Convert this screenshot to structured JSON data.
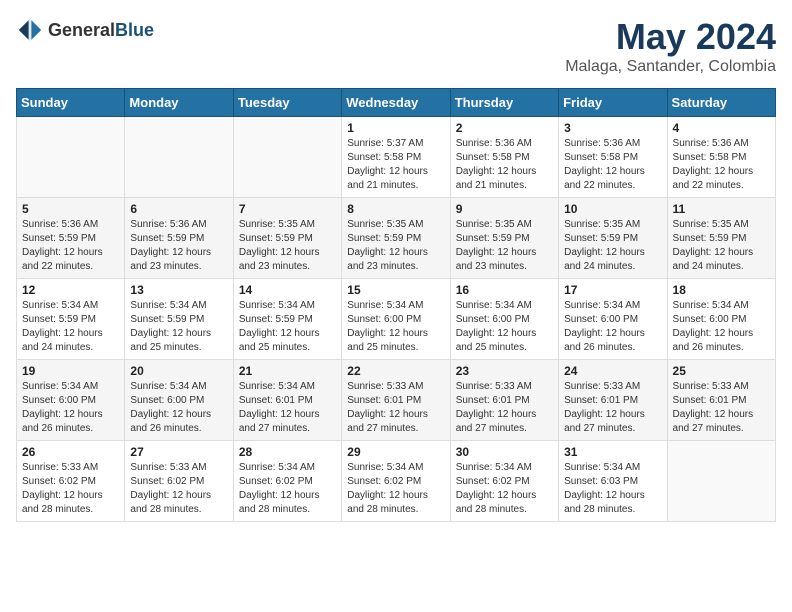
{
  "header": {
    "logo_general": "General",
    "logo_blue": "Blue",
    "title": "May 2024",
    "subtitle": "Malaga, Santander, Colombia"
  },
  "weekdays": [
    "Sunday",
    "Monday",
    "Tuesday",
    "Wednesday",
    "Thursday",
    "Friday",
    "Saturday"
  ],
  "weeks": [
    {
      "days": [
        {
          "num": "",
          "info": ""
        },
        {
          "num": "",
          "info": ""
        },
        {
          "num": "",
          "info": ""
        },
        {
          "num": "1",
          "info": "Sunrise: 5:37 AM\nSunset: 5:58 PM\nDaylight: 12 hours\nand 21 minutes."
        },
        {
          "num": "2",
          "info": "Sunrise: 5:36 AM\nSunset: 5:58 PM\nDaylight: 12 hours\nand 21 minutes."
        },
        {
          "num": "3",
          "info": "Sunrise: 5:36 AM\nSunset: 5:58 PM\nDaylight: 12 hours\nand 22 minutes."
        },
        {
          "num": "4",
          "info": "Sunrise: 5:36 AM\nSunset: 5:58 PM\nDaylight: 12 hours\nand 22 minutes."
        }
      ]
    },
    {
      "days": [
        {
          "num": "5",
          "info": "Sunrise: 5:36 AM\nSunset: 5:59 PM\nDaylight: 12 hours\nand 22 minutes."
        },
        {
          "num": "6",
          "info": "Sunrise: 5:36 AM\nSunset: 5:59 PM\nDaylight: 12 hours\nand 23 minutes."
        },
        {
          "num": "7",
          "info": "Sunrise: 5:35 AM\nSunset: 5:59 PM\nDaylight: 12 hours\nand 23 minutes."
        },
        {
          "num": "8",
          "info": "Sunrise: 5:35 AM\nSunset: 5:59 PM\nDaylight: 12 hours\nand 23 minutes."
        },
        {
          "num": "9",
          "info": "Sunrise: 5:35 AM\nSunset: 5:59 PM\nDaylight: 12 hours\nand 23 minutes."
        },
        {
          "num": "10",
          "info": "Sunrise: 5:35 AM\nSunset: 5:59 PM\nDaylight: 12 hours\nand 24 minutes."
        },
        {
          "num": "11",
          "info": "Sunrise: 5:35 AM\nSunset: 5:59 PM\nDaylight: 12 hours\nand 24 minutes."
        }
      ]
    },
    {
      "days": [
        {
          "num": "12",
          "info": "Sunrise: 5:34 AM\nSunset: 5:59 PM\nDaylight: 12 hours\nand 24 minutes."
        },
        {
          "num": "13",
          "info": "Sunrise: 5:34 AM\nSunset: 5:59 PM\nDaylight: 12 hours\nand 25 minutes."
        },
        {
          "num": "14",
          "info": "Sunrise: 5:34 AM\nSunset: 5:59 PM\nDaylight: 12 hours\nand 25 minutes."
        },
        {
          "num": "15",
          "info": "Sunrise: 5:34 AM\nSunset: 6:00 PM\nDaylight: 12 hours\nand 25 minutes."
        },
        {
          "num": "16",
          "info": "Sunrise: 5:34 AM\nSunset: 6:00 PM\nDaylight: 12 hours\nand 25 minutes."
        },
        {
          "num": "17",
          "info": "Sunrise: 5:34 AM\nSunset: 6:00 PM\nDaylight: 12 hours\nand 26 minutes."
        },
        {
          "num": "18",
          "info": "Sunrise: 5:34 AM\nSunset: 6:00 PM\nDaylight: 12 hours\nand 26 minutes."
        }
      ]
    },
    {
      "days": [
        {
          "num": "19",
          "info": "Sunrise: 5:34 AM\nSunset: 6:00 PM\nDaylight: 12 hours\nand 26 minutes."
        },
        {
          "num": "20",
          "info": "Sunrise: 5:34 AM\nSunset: 6:00 PM\nDaylight: 12 hours\nand 26 minutes."
        },
        {
          "num": "21",
          "info": "Sunrise: 5:34 AM\nSunset: 6:01 PM\nDaylight: 12 hours\nand 27 minutes."
        },
        {
          "num": "22",
          "info": "Sunrise: 5:33 AM\nSunset: 6:01 PM\nDaylight: 12 hours\nand 27 minutes."
        },
        {
          "num": "23",
          "info": "Sunrise: 5:33 AM\nSunset: 6:01 PM\nDaylight: 12 hours\nand 27 minutes."
        },
        {
          "num": "24",
          "info": "Sunrise: 5:33 AM\nSunset: 6:01 PM\nDaylight: 12 hours\nand 27 minutes."
        },
        {
          "num": "25",
          "info": "Sunrise: 5:33 AM\nSunset: 6:01 PM\nDaylight: 12 hours\nand 27 minutes."
        }
      ]
    },
    {
      "days": [
        {
          "num": "26",
          "info": "Sunrise: 5:33 AM\nSunset: 6:02 PM\nDaylight: 12 hours\nand 28 minutes."
        },
        {
          "num": "27",
          "info": "Sunrise: 5:33 AM\nSunset: 6:02 PM\nDaylight: 12 hours\nand 28 minutes."
        },
        {
          "num": "28",
          "info": "Sunrise: 5:34 AM\nSunset: 6:02 PM\nDaylight: 12 hours\nand 28 minutes."
        },
        {
          "num": "29",
          "info": "Sunrise: 5:34 AM\nSunset: 6:02 PM\nDaylight: 12 hours\nand 28 minutes."
        },
        {
          "num": "30",
          "info": "Sunrise: 5:34 AM\nSunset: 6:02 PM\nDaylight: 12 hours\nand 28 minutes."
        },
        {
          "num": "31",
          "info": "Sunrise: 5:34 AM\nSunset: 6:03 PM\nDaylight: 12 hours\nand 28 minutes."
        },
        {
          "num": "",
          "info": ""
        }
      ]
    }
  ]
}
